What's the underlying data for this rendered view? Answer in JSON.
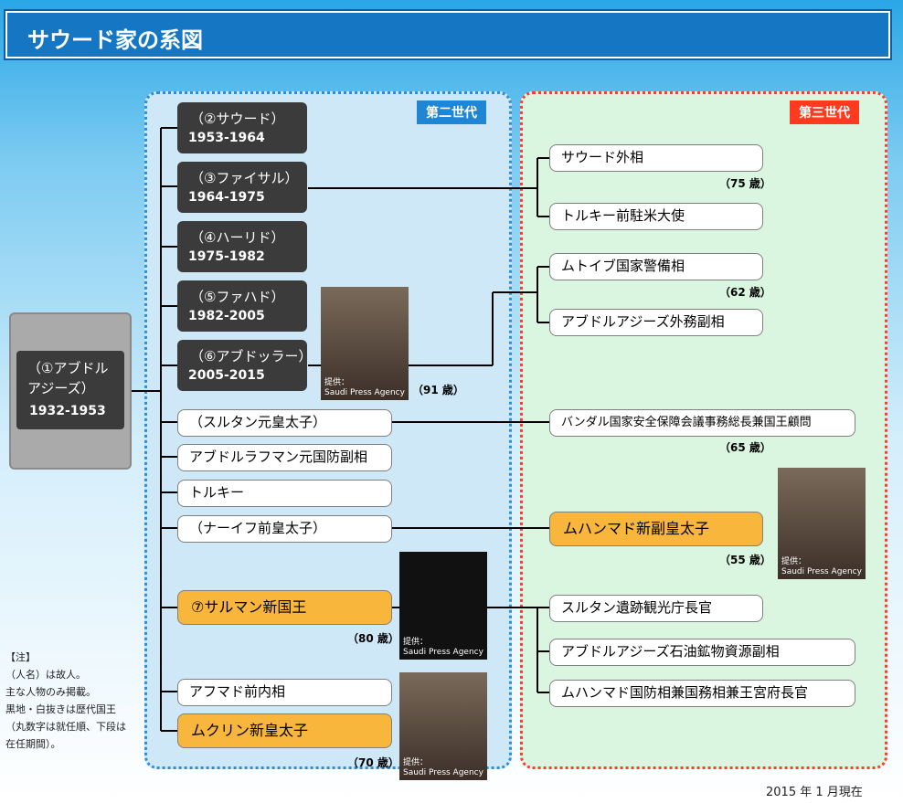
{
  "title": "サウード家の系図",
  "gen2_label": "第二世代",
  "gen3_label": "第三世代",
  "founder": {
    "name": "（①アブドル\nアジーズ）",
    "years": "1932-1953"
  },
  "kings": [
    {
      "name": "（②サウード）",
      "years": "1953-1964"
    },
    {
      "name": "（③ファイサル）",
      "years": "1964-1975"
    },
    {
      "name": "（④ハーリド）",
      "years": "1975-1982"
    },
    {
      "name": "（⑤ファハド）",
      "years": "1982-2005"
    },
    {
      "name": "（⑥アブドッラー）",
      "years": "2005-2015"
    }
  ],
  "gen2_others": [
    "（スルタン元皇太子）",
    "アブドルラフマン元国防副相",
    "トルキー",
    "（ナーイフ前皇太子）",
    "アフマド前内相"
  ],
  "salman": "⑦サルマン新国王",
  "muqrin": "ムクリン新皇太子",
  "gen3": {
    "faisal_sons": [
      "サウード外相",
      "トルキー前駐米大使"
    ],
    "abdullah_sons": [
      "ムトイブ国家警備相",
      "アブドルアジーズ外務副相"
    ],
    "sultan_son": "バンダル国家安全保障会議事務総長兼国王顧問",
    "nayef_son": "ムハンマド新副皇太子",
    "salman_sons": [
      "スルタン遺跡観光庁長官",
      "アブドルアジーズ石油鉱物資源副相",
      "ムハンマド国防相兼国務相兼王宮府長官"
    ]
  },
  "ages": {
    "saud": "（75 歳）",
    "mutaib": "（62 歳）",
    "bandar": "（65 歳）",
    "abdullah": "（91 歳）",
    "mohammed": "（55 歳）",
    "salman": "（80 歳）",
    "muqrin": "（70 歳）"
  },
  "photo_credit": "提供：\nSaudi Press Agency",
  "notes": [
    "【注】",
    "（人名）は故人。",
    "主な人物のみ掲載。",
    "黒地・白抜きは歴代国王",
    "（丸数字は就任順、下段は",
    "在任期間）。"
  ],
  "date": "2015 年 1 月現在"
}
